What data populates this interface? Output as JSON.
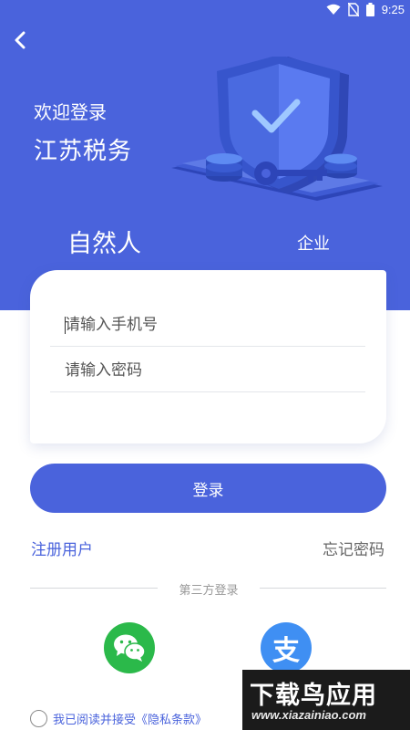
{
  "status_bar": {
    "time": "9:25",
    "icons": [
      "wifi-icon",
      "no-sim-icon",
      "battery-icon"
    ]
  },
  "header": {
    "back_icon": "chevron-left-icon",
    "welcome": "欢迎登录",
    "app_name": "江苏税务",
    "illustration": "shield-key-coins-illustration"
  },
  "tabs": {
    "natural_person": "自然人",
    "enterprise": "企业",
    "active": "natural_person"
  },
  "form": {
    "phone_placeholder": "请输入手机号",
    "phone_value": "",
    "password_placeholder": "请输入密码",
    "password_value": "",
    "login_label": "登录"
  },
  "links": {
    "register": "注册用户",
    "forgot": "忘记密码"
  },
  "third_party": {
    "label": "第三方登录",
    "wechat_icon": "wechat-icon",
    "alipay_icon": "alipay-icon",
    "alipay_glyph": "支"
  },
  "agreement": {
    "text": "我已阅读并接受《隐私条款》",
    "checked": false
  },
  "watermark": {
    "title": "下载鸟应用",
    "url": "www.xiazainiao.com"
  },
  "colors": {
    "primary": "#4a63dc",
    "wechat": "#2bb94a",
    "alipay": "#3f8ff3"
  }
}
